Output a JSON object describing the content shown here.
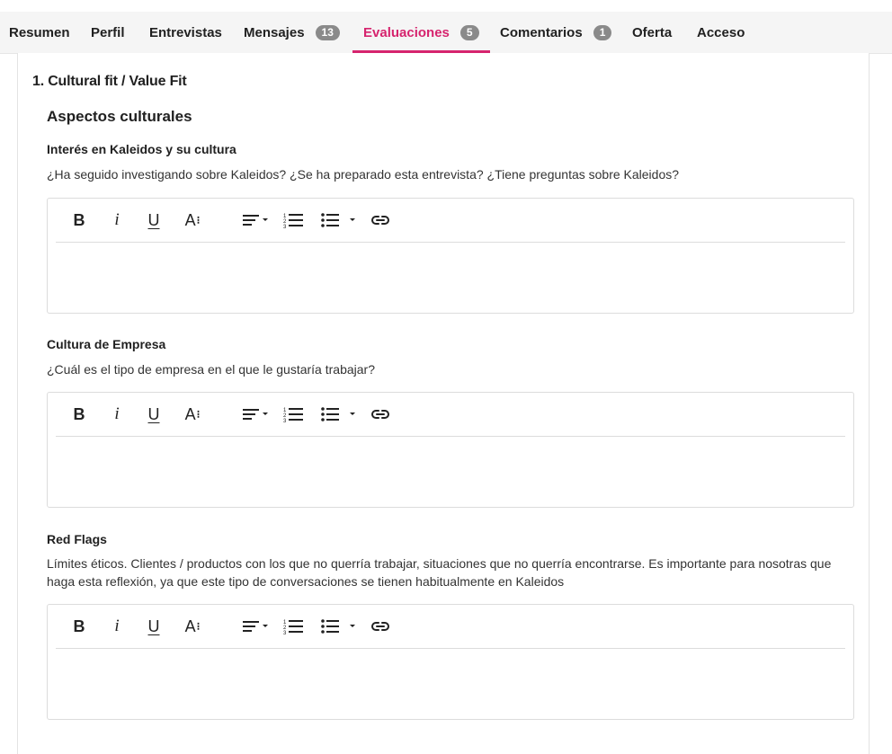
{
  "tabs": [
    {
      "label": "Resumen",
      "badge": null,
      "active": false
    },
    {
      "label": "Perfil",
      "badge": null,
      "active": false
    },
    {
      "label": "Entrevistas",
      "badge": null,
      "active": false
    },
    {
      "label": "Mensajes",
      "badge": "13",
      "active": false
    },
    {
      "label": "Evaluaciones",
      "badge": "5",
      "active": true
    },
    {
      "label": "Comentarios",
      "badge": "1",
      "active": false
    },
    {
      "label": "Oferta",
      "badge": null,
      "active": false
    },
    {
      "label": "Acceso",
      "badge": null,
      "active": false
    }
  ],
  "section_title": "1. Cultural fit / Value Fit",
  "subsection_title": "Aspectos culturales",
  "questions": [
    {
      "title": "Interés en Kaleidos y su cultura",
      "description": "¿Ha seguido investigando sobre Kaleidos? ¿Se ha preparado esta entrevista? ¿Tiene preguntas sobre Kaleidos?",
      "answer": ""
    },
    {
      "title": "Cultura de Empresa",
      "description": "¿Cuál es el tipo de empresa en el que le gustaría trabajar?",
      "answer": ""
    },
    {
      "title": "Red Flags",
      "description": "Límites éticos. Clientes / productos con los que no querría trabajar, situaciones que no querría encontrarse. Es importante para nosotras que haga esta reflexión, ya que este tipo de conversaciones se tienen habitualmente en Kaleidos",
      "answer": ""
    }
  ],
  "toolbar": {
    "bold": "B",
    "italic": "i",
    "underline": "U",
    "font_size": "A",
    "icons": [
      "align-icon",
      "ordered-list-icon",
      "bullet-list-icon",
      "link-icon"
    ]
  },
  "colors": {
    "accent": "#d6246e",
    "badge": "#8a8a8a",
    "tabbar": "#f5f5f5"
  }
}
